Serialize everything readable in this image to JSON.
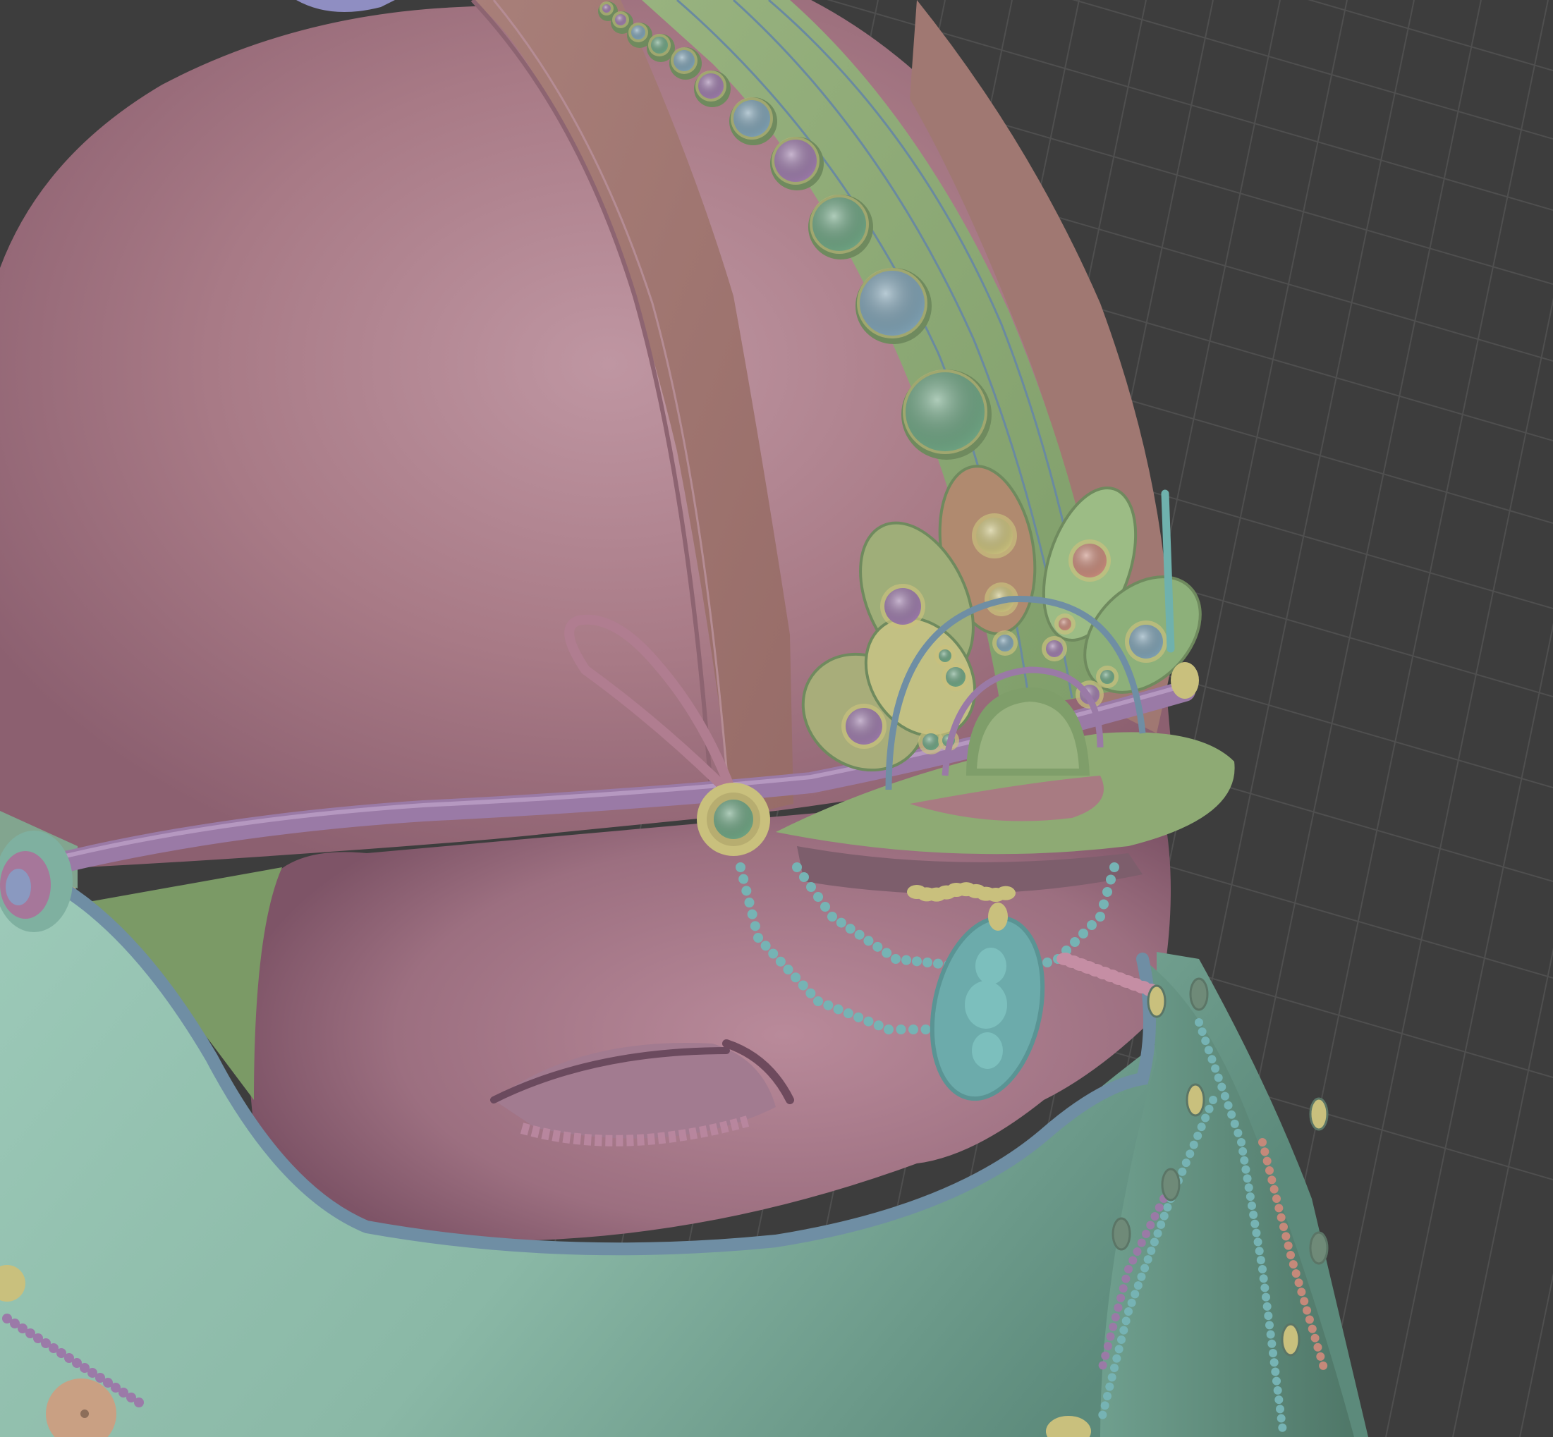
{
  "viewport": {
    "background_color": "#3d3d3d",
    "grid_color": "#4f4f4f",
    "shading_mode": "solid-random-color"
  },
  "object": {
    "type": "sculpted character head with ornate helmet",
    "material_colors": {
      "helmet_shell": "#a87a86",
      "helmet_panel": "#a47c74",
      "helmet_band": "#8eaa74",
      "strap": "#9a7aa6",
      "face": "#a8788a",
      "mask": "#93c1b2",
      "trim_cord": "#6f8ea4",
      "jewel_green": "#6ea382",
      "jewel_blue": "#7ea0b2",
      "jewel_violet": "#9b7aa8",
      "jewel_gold": "#c9c07d",
      "bead_teal": "#76b3b4",
      "bead_coral": "#c5897a",
      "medallion": "#6cabab"
    }
  }
}
